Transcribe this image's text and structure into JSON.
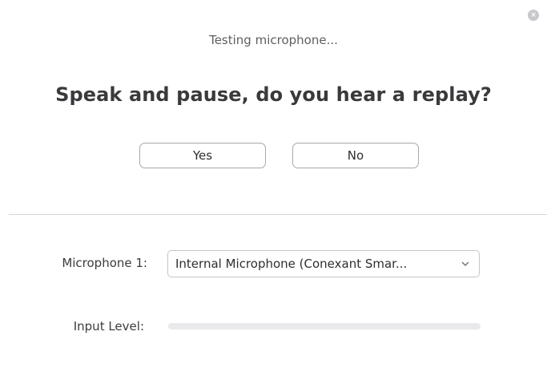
{
  "dialog": {
    "close_symbol": "×",
    "status_text": "Testing microphone...",
    "question": "Speak and pause, do you hear a replay?"
  },
  "actions": {
    "yes_label": "Yes",
    "no_label": "No"
  },
  "microphone": {
    "label": "Microphone 1:",
    "selected": "Internal Microphone (Conexant Smar..."
  },
  "input_level": {
    "label": "Input Level:",
    "level_fraction": 0
  },
  "icons": {
    "close": "close-icon",
    "dropdown": "chevron-down-icon"
  },
  "colors": {
    "close_button": "#c7c7cc",
    "button_border": "#a8a8ae",
    "level_track": "#e9e9ec",
    "level_fill": "#2d8cff"
  }
}
